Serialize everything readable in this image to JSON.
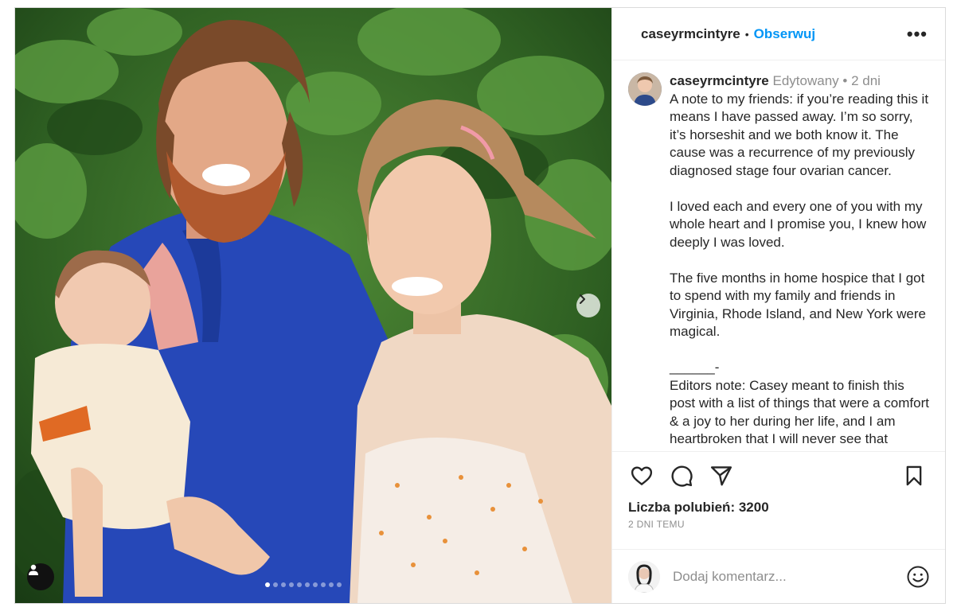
{
  "header": {
    "username": "caseyrmcintyre",
    "separator": "•",
    "follow_label": "Obserwuj",
    "more_label": "•••"
  },
  "caption": {
    "username": "caseyrmcintyre",
    "edited": "Edytowany •",
    "time": "2 dni",
    "paragraphs": [
      "A note to my friends: if you’re reading this it means I have passed away. I’m so sorry, it’s horseshit and we both know it. The cause was a recurrence of my previously diagnosed stage four ovarian cancer.",
      "I loved each and every one of you with my whole heart and I promise you, I knew how deeply I was loved.",
      "The five months in home hospice that I got to spend with my family and friends in Virginia, Rhode Island, and New York were magical.",
      "______-\nEditors note: Casey meant to finish this post with a list of things that were a comfort & a joy to her during her life, and I am heartbroken that I will never see that"
    ]
  },
  "actions": {
    "like_icon": "heart-icon",
    "comment_icon": "comment-icon",
    "share_icon": "send-icon",
    "save_icon": "bookmark-icon"
  },
  "likes": {
    "label": "Liczba polubień: 3200"
  },
  "date": "2 DNI TEMU",
  "comment": {
    "placeholder": "Dodaj komentarz...",
    "emoji_icon": "smiley-icon"
  },
  "carousel": {
    "count": 10,
    "active_index": 0
  },
  "colors": {
    "accent": "#0095f6",
    "muted": "#8e8e8e",
    "text": "#262626"
  }
}
